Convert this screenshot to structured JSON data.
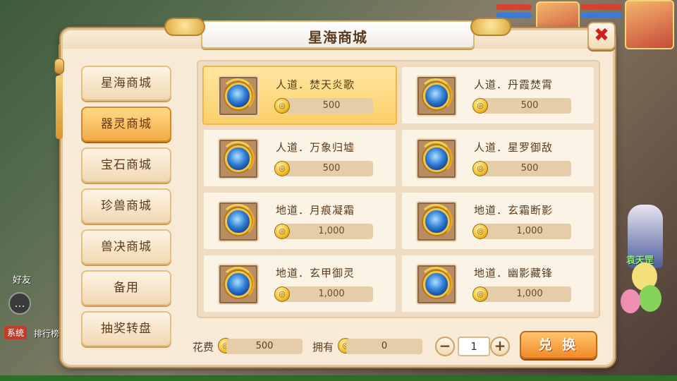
{
  "panel": {
    "title": "星海商城",
    "close_label": "✖"
  },
  "sidebar": {
    "items": [
      {
        "label": "星海商城",
        "active": false
      },
      {
        "label": "器灵商城",
        "active": true
      },
      {
        "label": "宝石商城",
        "active": false
      },
      {
        "label": "珍兽商城",
        "active": false
      },
      {
        "label": "兽决商城",
        "active": false
      },
      {
        "label": "备用",
        "active": false
      },
      {
        "label": "抽奖转盘",
        "active": false
      }
    ]
  },
  "items": [
    {
      "name": "人道．焚天炎歌",
      "price": "500",
      "selected": true
    },
    {
      "name": "人道．丹霞焚霄",
      "price": "500",
      "selected": false
    },
    {
      "name": "人道．万象归墟",
      "price": "500",
      "selected": false
    },
    {
      "name": "人道．星罗御敌",
      "price": "500",
      "selected": false
    },
    {
      "name": "地道．月痕凝霜",
      "price": "1,000",
      "selected": false
    },
    {
      "name": "地道．玄霜断影",
      "price": "1,000",
      "selected": false
    },
    {
      "name": "地道．玄甲御灵",
      "price": "1,000",
      "selected": false
    },
    {
      "name": "地道．幽影藏锋",
      "price": "1,000",
      "selected": false
    }
  ],
  "footer": {
    "cost_label": "花费",
    "cost_value": "500",
    "own_label": "拥有",
    "own_value": "0",
    "minus_label": "−",
    "plus_label": "+",
    "quantity": "1",
    "exchange_label": "兑 换"
  },
  "background": {
    "npc_name": "袁天罡",
    "friends_label": "好友",
    "system_label": "系统",
    "rank_label": "排行榜"
  },
  "colors": {
    "panel_bg": "#f7ead7",
    "selected_card": "#fbcf6a",
    "active_tab": "#f3ac48",
    "close_x": "#d0201c",
    "exchange_btn": "#f08a2a"
  },
  "icons": {
    "currency": "gold-coin-icon",
    "item": "dragon-gem-icon"
  }
}
